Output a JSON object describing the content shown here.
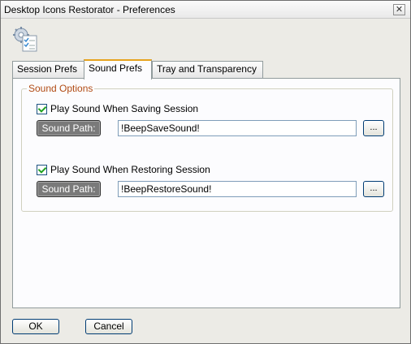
{
  "window": {
    "title": "Desktop Icons Restorator - Preferences",
    "close_glyph": "✕"
  },
  "app_icon": "preferences-gear-checklist-icon",
  "tabs": [
    {
      "label": "Session Prefs",
      "active": false
    },
    {
      "label": "Sound Prefs",
      "active": true
    },
    {
      "label": "Tray and Transparency",
      "active": false
    }
  ],
  "sound_options": {
    "group_title": "Sound Options",
    "saving": {
      "checkbox_label": "Play Sound When Saving Session",
      "checked": true,
      "path_button_label": "Sound Path:",
      "path_value": "!BeepSaveSound!",
      "browse_label": "..."
    },
    "restoring": {
      "checkbox_label": "Play Sound When Restoring Session",
      "checked": true,
      "path_button_label": "Sound Path:",
      "path_value": "!BeepRestoreSound!",
      "browse_label": "..."
    }
  },
  "buttons": {
    "ok": "OK",
    "cancel": "Cancel"
  },
  "colors": {
    "group_title": "#b14b14",
    "active_tab_accent": "#e6a31e",
    "sound_path_button": "#7a7a7a"
  }
}
